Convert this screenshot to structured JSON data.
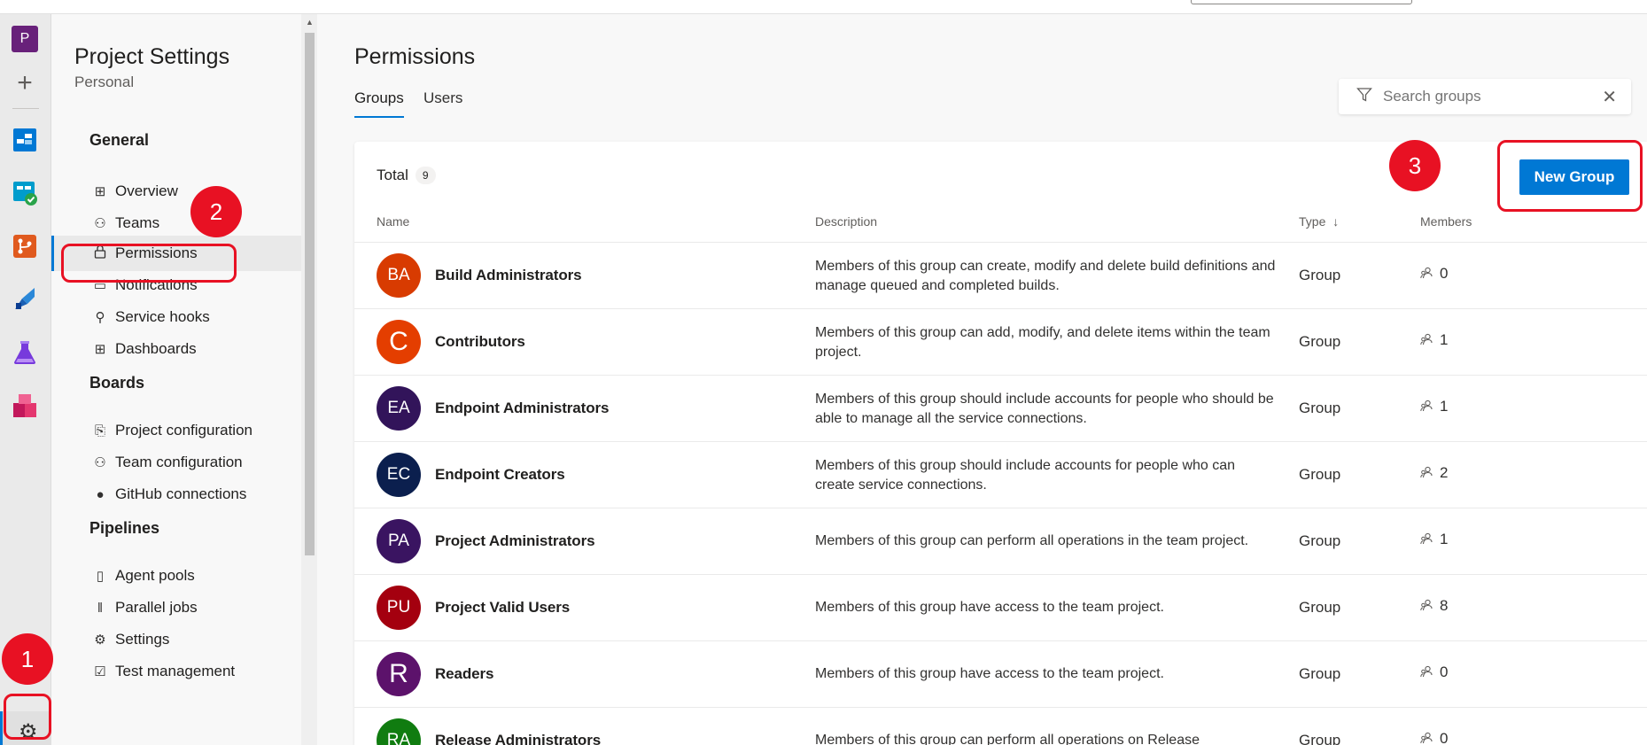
{
  "rail": {
    "project_initial": "P",
    "add_symbol": "+",
    "icons": [
      "boards-icon",
      "boards-check-icon",
      "repos-icon",
      "pipelines-icon",
      "test-plans-icon",
      "artifacts-icon"
    ]
  },
  "nav": {
    "title": "Project Settings",
    "subtitle": "Personal",
    "sections": {
      "general": "General",
      "boards": "Boards",
      "pipelines": "Pipelines"
    },
    "items": [
      {
        "label": "Overview",
        "icon": "overview-icon"
      },
      {
        "label": "Teams",
        "icon": "teams-icon"
      },
      {
        "label": "Permissions",
        "icon": "lock-icon"
      },
      {
        "label": "Notifications",
        "icon": "notifications-icon"
      },
      {
        "label": "Service hooks",
        "icon": "service-hooks-icon"
      },
      {
        "label": "Dashboards",
        "icon": "dashboards-icon"
      },
      {
        "label": "Project configuration",
        "icon": "project-configuration-icon"
      },
      {
        "label": "Team configuration",
        "icon": "team-configuration-icon"
      },
      {
        "label": "GitHub connections",
        "icon": "github-icon"
      },
      {
        "label": "Agent pools",
        "icon": "agent-pools-icon"
      },
      {
        "label": "Parallel jobs",
        "icon": "parallel-jobs-icon"
      },
      {
        "label": "Settings",
        "icon": "settings-icon"
      },
      {
        "label": "Test management",
        "icon": "test-management-icon"
      }
    ]
  },
  "main": {
    "title": "Permissions",
    "tabs": [
      "Groups",
      "Users"
    ],
    "search_placeholder": "Search groups",
    "total_label": "Total",
    "total_count": "9",
    "new_group_label": "New Group",
    "columns": {
      "name": "Name",
      "description": "Description",
      "type": "Type",
      "type_sort": "↓",
      "members": "Members"
    },
    "groups": [
      {
        "initials": "BA",
        "name": "Build Administrators",
        "description": "Members of this group can create, modify and delete build definitions and manage queued and completed builds.",
        "type": "Group",
        "members": "0",
        "color": "#d83b01"
      },
      {
        "initials": "C",
        "name": "Contributors",
        "description": "Members of this group can add, modify, and delete items within the team project.",
        "type": "Group",
        "members": "1",
        "color": "#e43e00"
      },
      {
        "initials": "EA",
        "name": "Endpoint Administrators",
        "description": "Members of this group should include accounts for people who should be able to manage all the service connections.",
        "type": "Group",
        "members": "1",
        "color": "#32145a"
      },
      {
        "initials": "EC",
        "name": "Endpoint Creators",
        "description": "Members of this group should include accounts for people who can create service connections.",
        "type": "Group",
        "members": "2",
        "color": "#0b1f4e"
      },
      {
        "initials": "PA",
        "name": "Project Administrators",
        "description": "Members of this group can perform all operations in the team project.",
        "type": "Group",
        "members": "1",
        "color": "#3a1461"
      },
      {
        "initials": "PU",
        "name": "Project Valid Users",
        "description": "Members of this group have access to the team project.",
        "type": "Group",
        "members": "8",
        "color": "#a4000f"
      },
      {
        "initials": "R",
        "name": "Readers",
        "description": "Members of this group have access to the team project.",
        "type": "Group",
        "members": "0",
        "color": "#5c126b"
      },
      {
        "initials": "RA",
        "name": "Release Administrators",
        "description": "Members of this group can perform all operations on Release",
        "type": "Group",
        "members": "0",
        "color": "#107c10"
      }
    ]
  },
  "annotations": [
    "1",
    "2",
    "3"
  ],
  "colors": {
    "accent": "#0078d4",
    "annotation": "#e81123"
  }
}
